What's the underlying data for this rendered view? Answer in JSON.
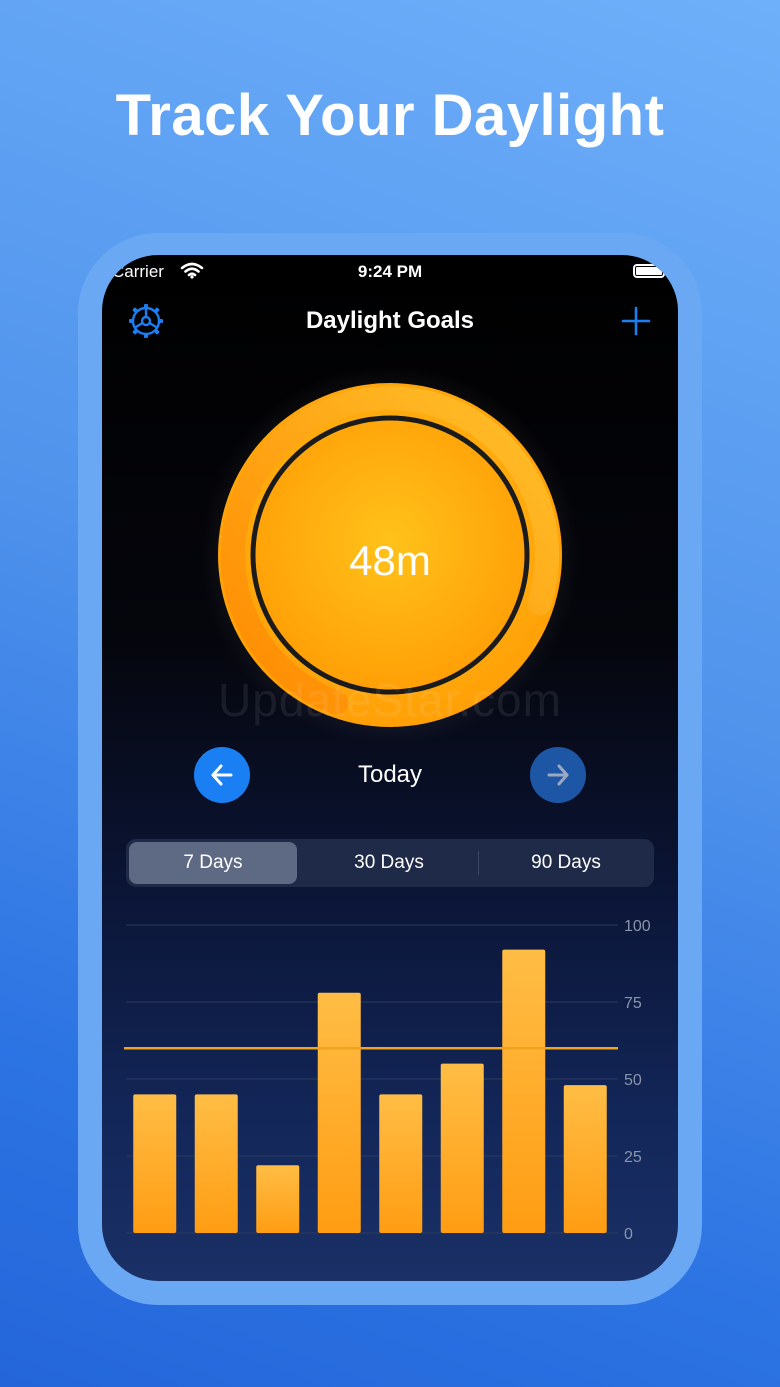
{
  "headline": "Track Your Daylight",
  "status_bar": {
    "carrier": "Carrier",
    "time": "9:24 PM"
  },
  "nav": {
    "title": "Daylight Goals",
    "settings_icon": "gear-icon",
    "add_icon": "plus-icon"
  },
  "progress": {
    "value_text": "48m",
    "minutes": 48,
    "goal_minutes": 60,
    "fraction": 0.8,
    "colors": {
      "fill_start": "#ffb30f",
      "fill_end": "#ff9a05",
      "arc_start": "#ff8a00",
      "arc_end": "#ffc02a",
      "track": "#1b1b1b"
    }
  },
  "watermark": "UpdateStar.com",
  "day_nav": {
    "label": "Today",
    "prev_icon": "arrow-left-icon",
    "next_icon": "arrow-right-icon"
  },
  "range_tabs": [
    {
      "label": "7 Days",
      "selected": true
    },
    {
      "label": "30 Days",
      "selected": false
    },
    {
      "label": "90 Days",
      "selected": false
    }
  ],
  "chart_data": {
    "type": "bar",
    "values": [
      45,
      45,
      22,
      78,
      45,
      55,
      92,
      48
    ],
    "y_ticks": [
      "100",
      "75",
      "50",
      "25",
      "0"
    ],
    "ylim": [
      0,
      100
    ],
    "goal_line": 60,
    "grid": true,
    "colors": {
      "bar_top": "#ffbd45",
      "bar_bottom": "#ff9d13",
      "goal": "#f2a31c",
      "grid": "#2d3a5e",
      "tick": "#8a94ad"
    }
  },
  "colors": {
    "accent": "#1a7ff2",
    "accent_dim": "#1e56a6",
    "bg_top": "#6fb0fa",
    "bg_bottom": "#2466da"
  }
}
